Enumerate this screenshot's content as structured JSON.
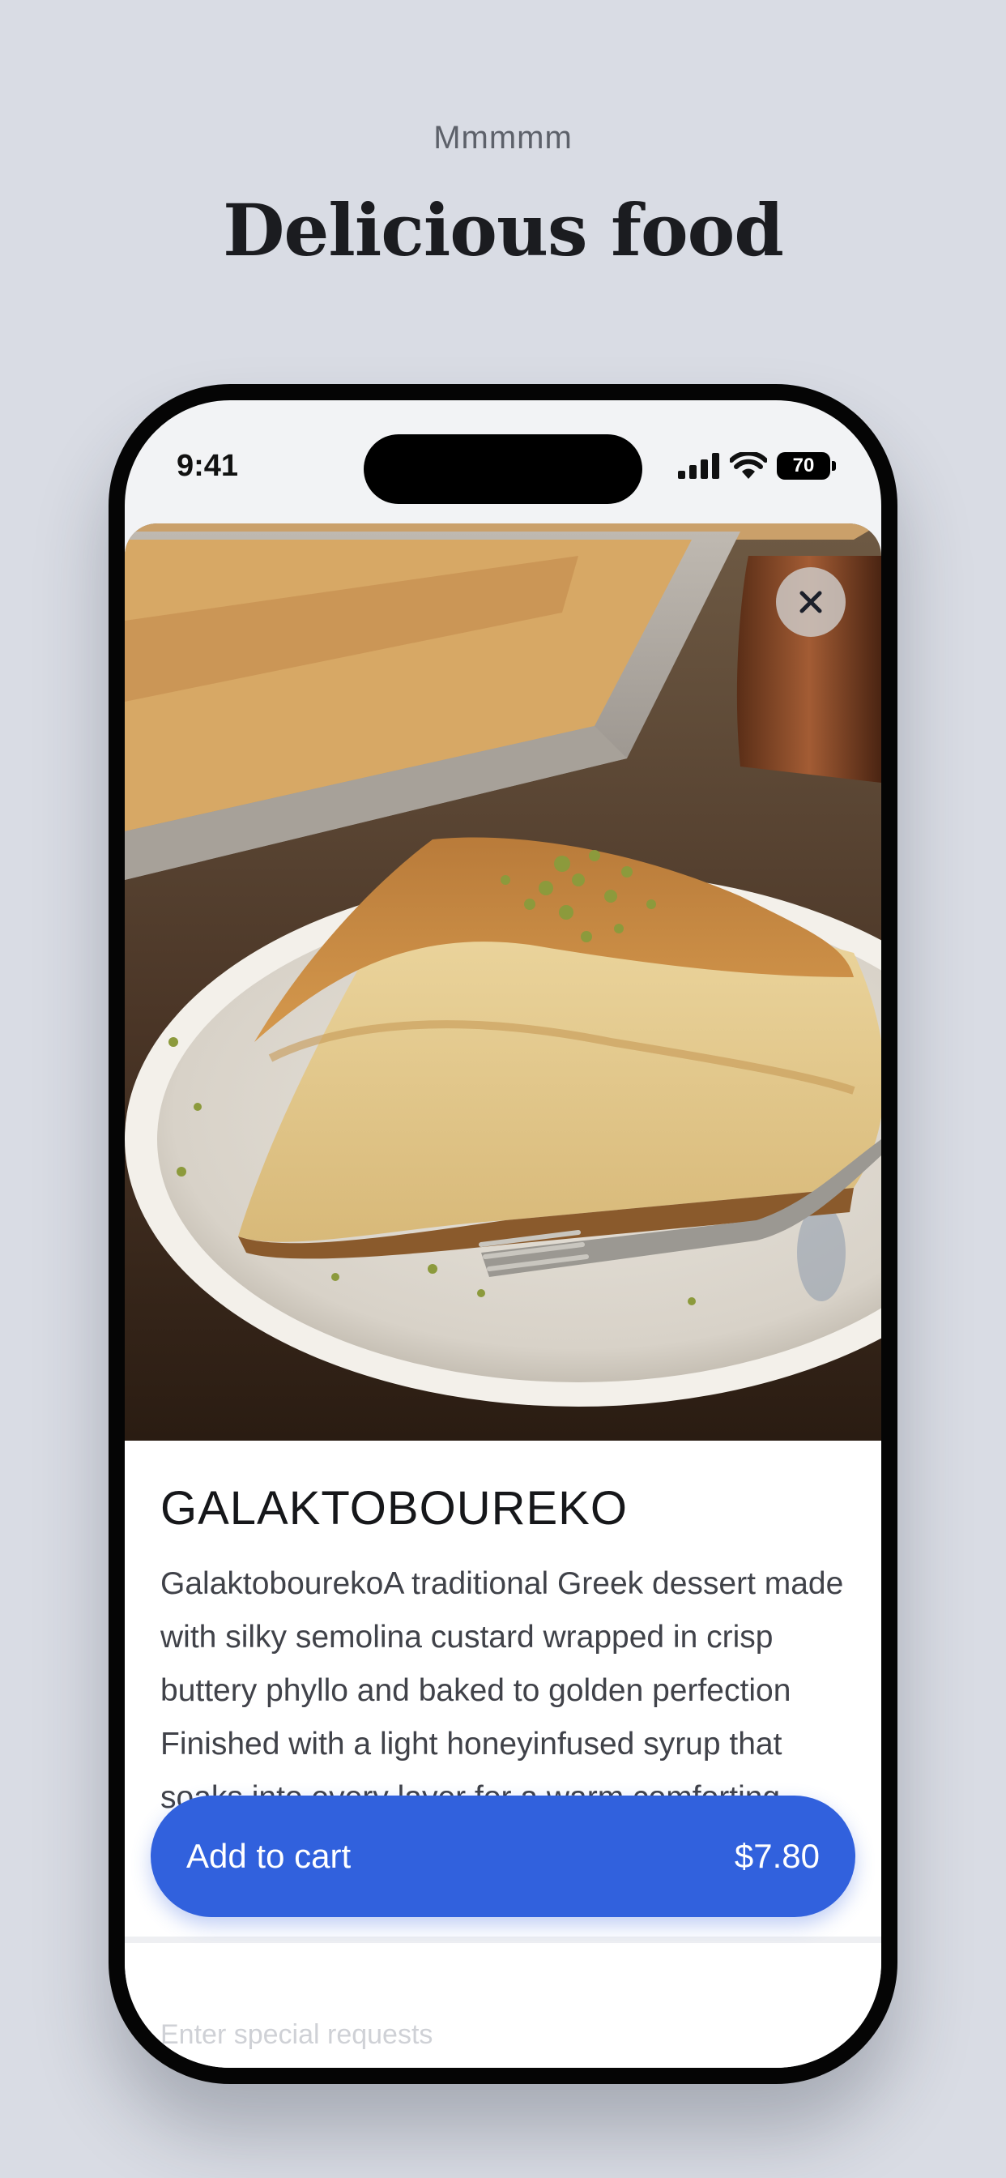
{
  "page": {
    "eyebrow": "Mmmmm",
    "headline": "Delicious food"
  },
  "status_bar": {
    "time": "9:41",
    "battery": "70"
  },
  "product": {
    "title": "GALAKTOBOUREKO",
    "description": "GalaktobourekoA traditional Greek dessert made with silky semolina custard wrapped in crisp buttery phyllo and baked to golden perfection Finished with a light honeyinfused syrup that soaks into every layer for a warm comforting sweetness",
    "image_icon": "food-photo-galaktoboureko"
  },
  "special_requests": {
    "placeholder": "Enter special requests"
  },
  "cart": {
    "label": "Add to cart",
    "price": "$7.80"
  },
  "colors": {
    "background": "#d9dce4",
    "accent": "#3161dd",
    "text_primary": "#16171a",
    "text_secondary": "#404249"
  }
}
